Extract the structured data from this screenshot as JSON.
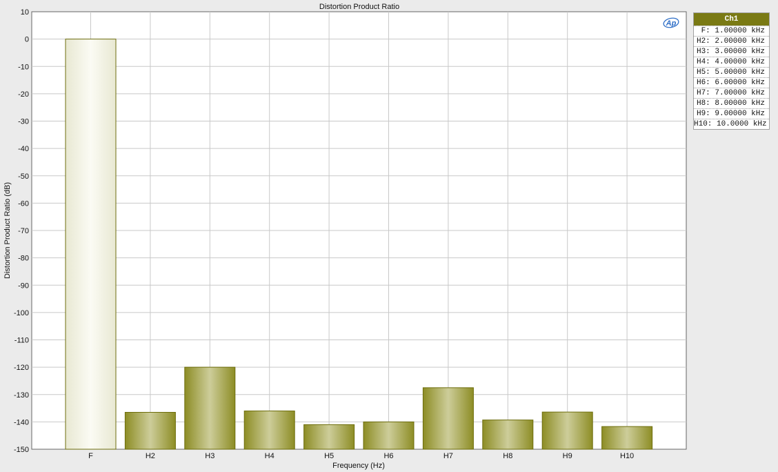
{
  "chart_data": {
    "type": "bar",
    "title": "Distortion Product Ratio",
    "xlabel": "Frequency (Hz)",
    "ylabel": "Distortion Product Ratio (dB)",
    "ylim": [
      -150,
      10
    ],
    "yticks": [
      10,
      0,
      -10,
      -20,
      -30,
      -40,
      -50,
      -60,
      -70,
      -80,
      -90,
      -100,
      -110,
      -120,
      -130,
      -140,
      -150
    ],
    "grid": true,
    "categories": [
      "F",
      "H2",
      "H3",
      "H4",
      "H5",
      "H6",
      "H7",
      "H8",
      "H9",
      "H10"
    ],
    "values": [
      0,
      -136.5,
      -120,
      -136,
      -141,
      -140,
      -127.5,
      -139.3,
      -136.4,
      -141.7
    ],
    "colors": {
      "fundamental_fill": "#f1f1e2",
      "harmonic_fill_dark": "#8d8d25",
      "harmonic_fill_light": "#cdcd9a",
      "bar_border": "#6d6d0c",
      "legend_header": "#7a7a14"
    }
  },
  "legend": {
    "header": "Ch1",
    "placement": "right",
    "entries": [
      "F: 1.00000 kHz",
      "H2: 2.00000 kHz",
      "H3: 3.00000 kHz",
      "H4: 4.00000 kHz",
      "H5: 5.00000 kHz",
      "H6: 6.00000 kHz",
      "H7: 7.00000 kHz",
      "H8: 8.00000 kHz",
      "H9: 9.00000 kHz",
      "H10: 10.0000 kHz"
    ]
  },
  "logo": {
    "text": "AP",
    "icon": "ap-logo-icon"
  }
}
